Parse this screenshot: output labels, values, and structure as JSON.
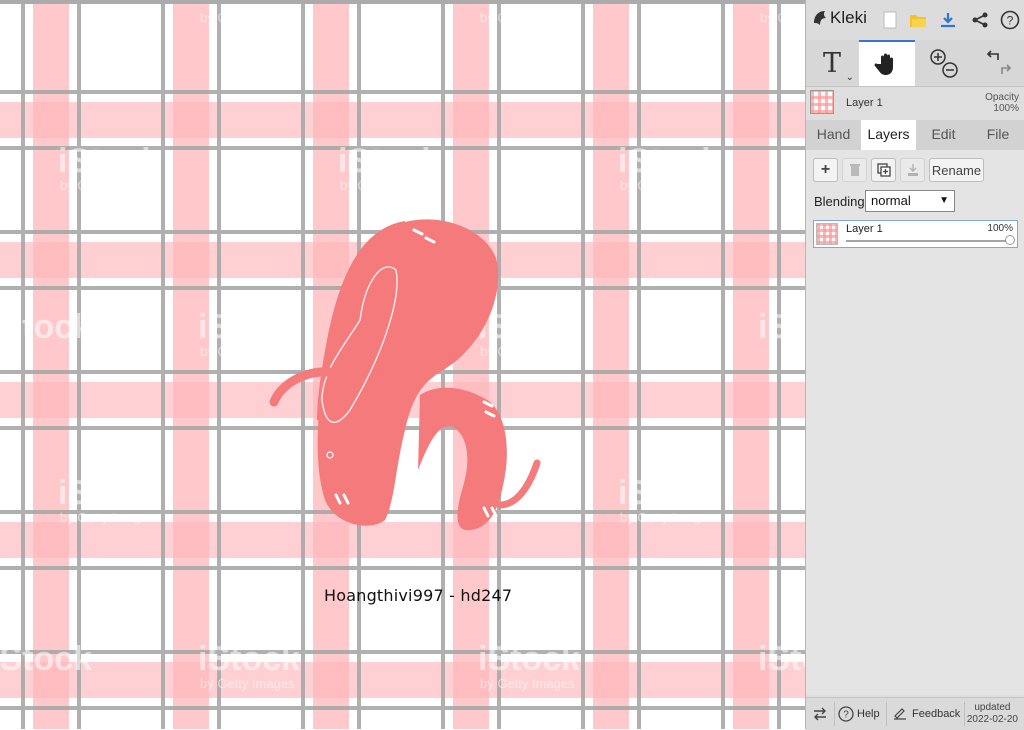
{
  "canvas": {
    "signature": "Hoangthivi997 - hd247",
    "watermark_main": "iStock",
    "watermark_sub": "by Getty Images",
    "colors": {
      "stripe": "#ffb7bb",
      "grid": "#a8a8a8",
      "letter": "#f47a7b"
    }
  },
  "app": {
    "name": "Kleki"
  },
  "topbar": {
    "icons": [
      "new-image-icon",
      "open-folder-icon",
      "download-icon",
      "share-icon",
      "help-icon"
    ]
  },
  "toolbar": {
    "text_tool_label": "T",
    "tools": [
      "text-tool-icon",
      "hand-tool-icon",
      "zoom-in-icon",
      "zoom-out-icon",
      "undo-icon",
      "redo-icon"
    ]
  },
  "layer_info": {
    "name": "Layer 1",
    "opacity_label": "Opacity",
    "opacity_value": "100%"
  },
  "tabs": [
    {
      "label": "Hand",
      "active": false
    },
    {
      "label": "Layers",
      "active": true
    },
    {
      "label": "Edit",
      "active": false
    },
    {
      "label": "File",
      "active": false
    }
  ],
  "layers_panel": {
    "buttons": {
      "add": "+",
      "rename": "Rename"
    },
    "blending_label": "Blending",
    "blending_value": "normal",
    "layers": [
      {
        "name": "Layer 1",
        "opacity": "100%",
        "opacity_fraction": 1.0
      }
    ]
  },
  "bottombar": {
    "help_label": "Help",
    "feedback_label": "Feedback",
    "updated_label": "updated",
    "updated_date": "2022-02-20"
  },
  "accent_color": "#3b73c8"
}
